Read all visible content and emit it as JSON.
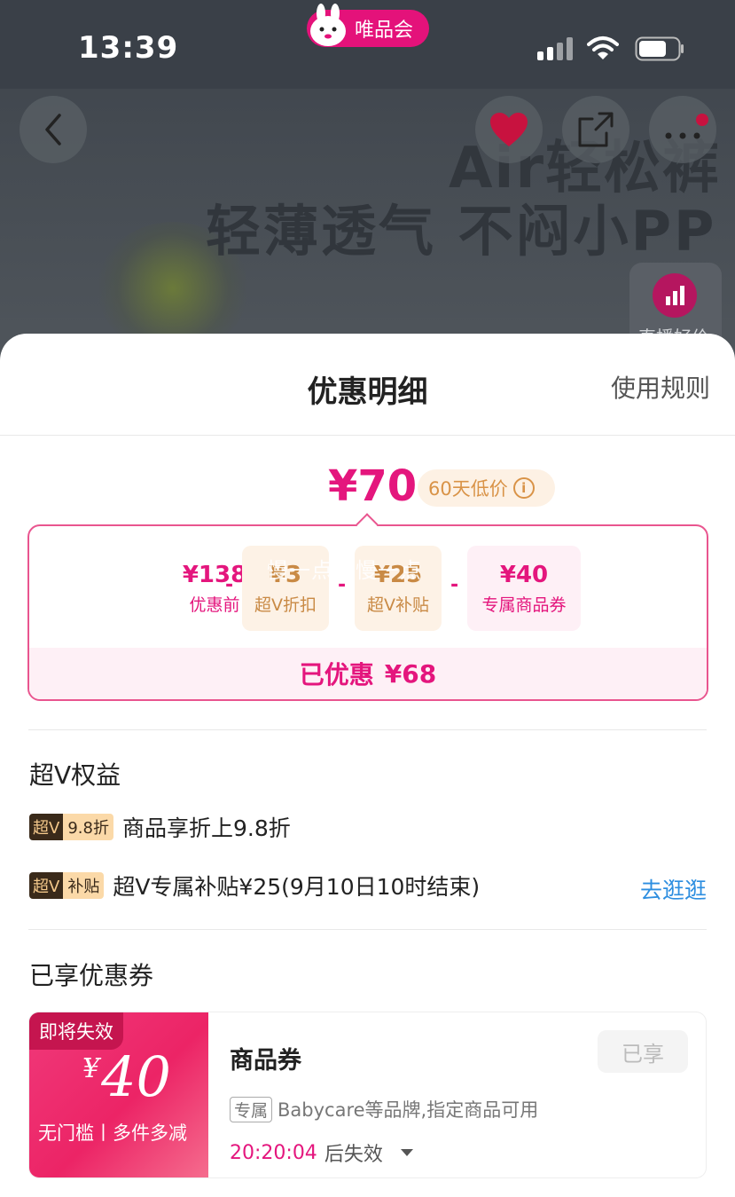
{
  "status_bar": {
    "time": "13:39",
    "app_badge": "唯品会"
  },
  "background": {
    "hero_line1": "Air轻松裤",
    "hero_line2": "轻薄透气 不闷小PP",
    "live_label": "直播好价"
  },
  "sheet": {
    "title": "优惠明细",
    "rules_link": "使用规则",
    "final_price": "¥70",
    "low_price_tag": "60天低价",
    "breakdown": {
      "items": [
        {
          "value": "¥138",
          "label": "优惠前"
        },
        {
          "value": "¥3",
          "label": "超V折扣"
        },
        {
          "value": "¥25",
          "label": "超V补贴"
        },
        {
          "value": "¥40",
          "label": "专属商品券"
        }
      ],
      "overlay_text": "慢一点再慢一点",
      "saved_label": "已优惠",
      "saved_amount": "¥68"
    },
    "vip_section": {
      "title": "超V权益",
      "rows": [
        {
          "tag_a": "超V",
          "tag_b": "9.8折",
          "text": "商品享折上9.8折"
        },
        {
          "tag_a": "超V",
          "tag_b": "补贴",
          "text": "超V专属补贴¥25(9月10日10时结束)",
          "action": "去逛逛"
        }
      ]
    },
    "coupon_section": {
      "title": "已享优惠券",
      "coupon": {
        "badge": "即将失效",
        "currency": "¥",
        "amount": "40",
        "condition": "无门槛丨多件多减",
        "name": "商品券",
        "status": "已享",
        "exclusive_tag": "专属",
        "description": "Babycare等品牌,指定商品可用",
        "countdown": "20:20:04",
        "expire_suffix": "后失效"
      }
    }
  },
  "colors": {
    "accent": "#e4167d",
    "link": "#2d8ee0",
    "tag_dark": "#3a2a1a",
    "tag_gold": "#fbd9a8"
  }
}
